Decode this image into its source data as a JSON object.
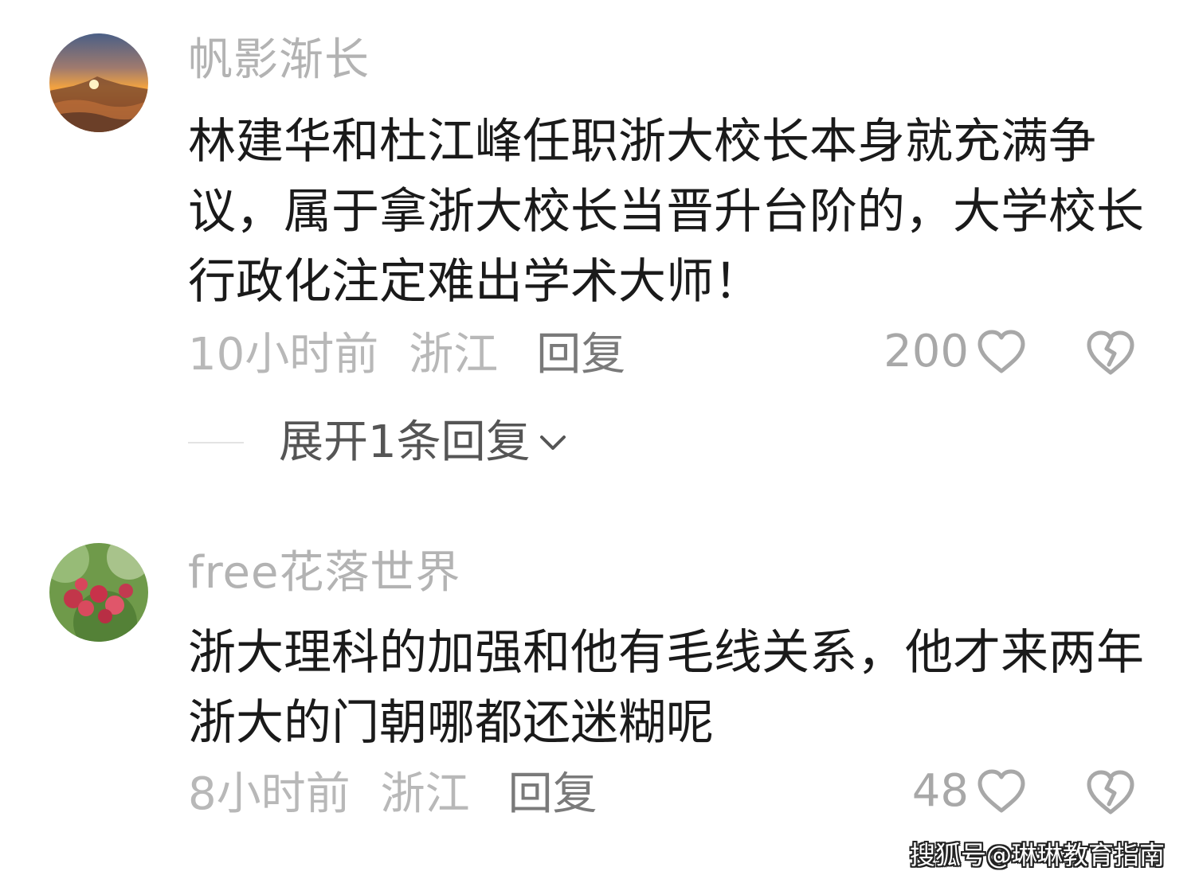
{
  "comments": [
    {
      "username": "帆影渐长",
      "text": "林建华和杜江峰任职浙大校长本身就充满争议，属于拿浙大校长当晋升台阶的，大学校长行政化注定难出学术大师！",
      "time": "10小时前",
      "region": "浙江",
      "reply_label": "回复",
      "likes": "200",
      "expand_label": "展开1条回复"
    },
    {
      "username": "free花落世界",
      "text": "浙大理科的加强和他有毛线关系，他才来两年浙大的门朝哪都还迷糊呢",
      "time": "8小时前",
      "region": "浙江",
      "reply_label": "回复",
      "likes": "48"
    }
  ],
  "watermark": "搜狐号@琳琳教育指南",
  "icons": {
    "like": "heart-outline-icon",
    "dislike": "broken-heart-icon",
    "expand": "chevron-down-icon"
  },
  "colors": {
    "username": "#b3b3b3",
    "meta": "#b8b8b8",
    "reply": "#7a7a7a",
    "icon": "#a8a8a8"
  }
}
